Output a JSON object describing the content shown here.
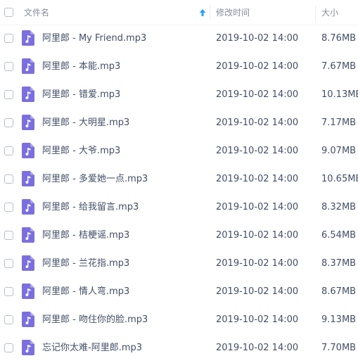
{
  "header": {
    "name_label": "文件名",
    "date_label": "修改时间",
    "size_label": "大小",
    "sort_icon": "arrow-up-icon",
    "sort_color": "#2aa3f5"
  },
  "file_icon": {
    "name": "music-file-icon",
    "color": "#7b6fdf"
  },
  "files": [
    {
      "name": "阿里郎 - My Friend.mp3",
      "modified": "2019-10-02 14:00",
      "size": "8.76MB"
    },
    {
      "name": "阿里郎 - 本能.mp3",
      "modified": "2019-10-02 14:00",
      "size": "7.67MB"
    },
    {
      "name": "阿里郎 - 错爱.mp3",
      "modified": "2019-10-02 14:00",
      "size": "10.13MB"
    },
    {
      "name": "阿里郎 - 大明星.mp3",
      "modified": "2019-10-02 14:00",
      "size": "7.17MB"
    },
    {
      "name": "阿里郎 - 大爷.mp3",
      "modified": "2019-10-02 14:00",
      "size": "9.07MB"
    },
    {
      "name": "阿里郎 - 多爱她一点.mp3",
      "modified": "2019-10-02 14:00",
      "size": "10.65MB"
    },
    {
      "name": "阿里郎 - 给我留言.mp3",
      "modified": "2019-10-02 14:00",
      "size": "8.32MB"
    },
    {
      "name": "阿里郎 - 桔梗谣.mp3",
      "modified": "2019-10-02 14:00",
      "size": "6.54MB"
    },
    {
      "name": "阿里郎 - 兰花指.mp3",
      "modified": "2019-10-02 14:00",
      "size": "8.37MB"
    },
    {
      "name": "阿里郎 - 情人弯.mp3",
      "modified": "2019-10-02 14:00",
      "size": "8.67MB"
    },
    {
      "name": "阿里郎 - 吻住你的脸.mp3",
      "modified": "2019-10-02 14:00",
      "size": "9.13MB"
    },
    {
      "name": "忘记你太难-阿里郎.mp3",
      "modified": "2019-10-02 14:00",
      "size": "7.70MB"
    }
  ]
}
